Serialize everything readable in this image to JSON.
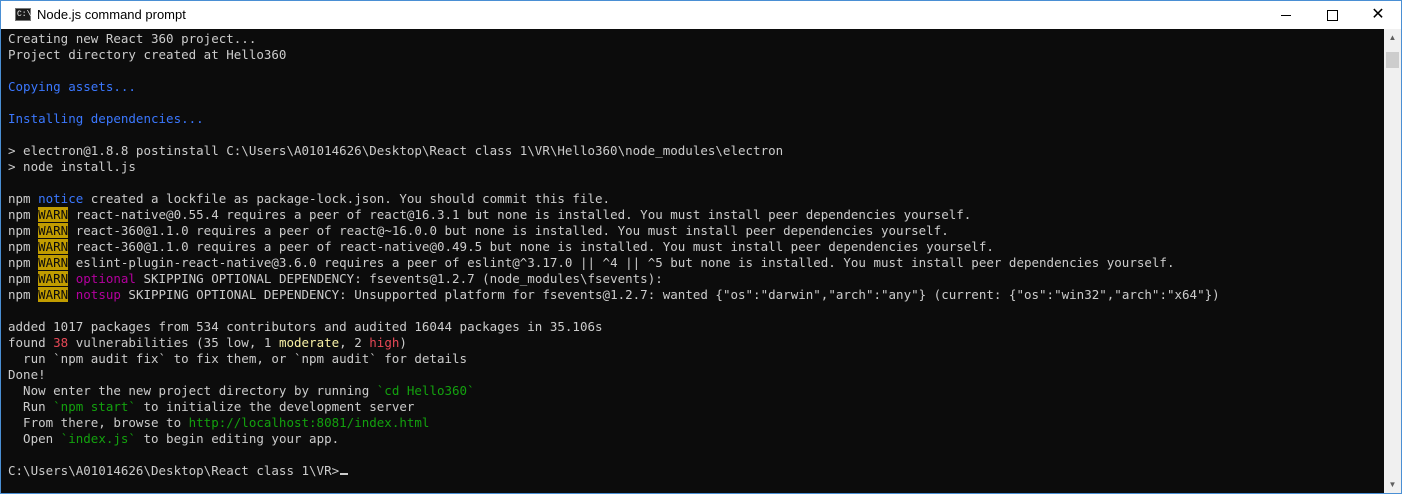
{
  "window": {
    "title": "Node.js command prompt",
    "icon_text": "C:\\",
    "minimize_symbol": "",
    "close_symbol": "✕"
  },
  "colors": {
    "console_bg": "#0c0c0c",
    "text": "#cccccc",
    "blue": "#3b78ff",
    "warn_bg": "#c19c00",
    "magenta": "#b4009e",
    "red": "#e74856",
    "yellow": "#f9f1a5",
    "green": "#13a10e"
  },
  "console": {
    "lines": [
      [
        {
          "t": "Creating new React 360 project..."
        }
      ],
      [
        {
          "t": "Project directory created at Hello360"
        }
      ],
      [],
      [
        {
          "t": "Copying assets...",
          "c": "blue"
        }
      ],
      [],
      [
        {
          "t": "Installing dependencies...",
          "c": "blue"
        }
      ],
      [],
      [
        {
          "t": "> electron@1.8.8 postinstall C:\\Users\\A01014626\\Desktop\\React class 1\\VR\\Hello360\\node_modules\\electron"
        }
      ],
      [
        {
          "t": "> node install.js"
        }
      ],
      [],
      [
        {
          "t": "npm "
        },
        {
          "t": "notice",
          "c": "blue"
        },
        {
          "t": " created a lockfile as package-lock.json. You should commit this file."
        }
      ],
      [
        {
          "t": "npm "
        },
        {
          "t": "WARN",
          "c": "warn"
        },
        {
          "t": " react-native@0.55.4 requires a peer of react@16.3.1 but none is installed. You must install peer dependencies yourself."
        }
      ],
      [
        {
          "t": "npm "
        },
        {
          "t": "WARN",
          "c": "warn"
        },
        {
          "t": " react-360@1.1.0 requires a peer of react@~16.0.0 but none is installed. You must install peer dependencies yourself."
        }
      ],
      [
        {
          "t": "npm "
        },
        {
          "t": "WARN",
          "c": "warn"
        },
        {
          "t": " react-360@1.1.0 requires a peer of react-native@0.49.5 but none is installed. You must install peer dependencies yourself."
        }
      ],
      [
        {
          "t": "npm "
        },
        {
          "t": "WARN",
          "c": "warn"
        },
        {
          "t": " eslint-plugin-react-native@3.6.0 requires a peer of eslint@^3.17.0 || ^4 || ^5 but none is installed. You must install peer dependencies yourself."
        }
      ],
      [
        {
          "t": "npm "
        },
        {
          "t": "WARN",
          "c": "warn"
        },
        {
          "t": " "
        },
        {
          "t": "optional",
          "c": "magenta"
        },
        {
          "t": " SKIPPING OPTIONAL DEPENDENCY: fsevents@1.2.7 (node_modules\\fsevents):"
        }
      ],
      [
        {
          "t": "npm "
        },
        {
          "t": "WARN",
          "c": "warn"
        },
        {
          "t": " "
        },
        {
          "t": "notsup",
          "c": "magenta"
        },
        {
          "t": " SKIPPING OPTIONAL DEPENDENCY: Unsupported platform for fsevents@1.2.7: wanted {\"os\":\"darwin\",\"arch\":\"any\"} (current: {\"os\":\"win32\",\"arch\":\"x64\"})"
        }
      ],
      [],
      [
        {
          "t": "added 1017 packages from 534 contributors and audited 16044 packages in 35.106s"
        }
      ],
      [
        {
          "t": "found "
        },
        {
          "t": "38",
          "c": "red"
        },
        {
          "t": " vulnerabilities (35 low, 1 "
        },
        {
          "t": "moderate",
          "c": "yellow"
        },
        {
          "t": ", 2 "
        },
        {
          "t": "high",
          "c": "red"
        },
        {
          "t": ")"
        }
      ],
      [
        {
          "t": "  run `npm audit fix` to fix them, or `npm audit` for details"
        }
      ],
      [
        {
          "t": "Done!"
        }
      ],
      [
        {
          "t": "  Now enter the new project directory by running "
        },
        {
          "t": "`cd Hello360`",
          "c": "green"
        }
      ],
      [
        {
          "t": "  Run "
        },
        {
          "t": "`npm start`",
          "c": "green"
        },
        {
          "t": " to initialize the development server"
        }
      ],
      [
        {
          "t": "  From there, browse to "
        },
        {
          "t": "http://localhost:8081/index.html",
          "c": "green"
        }
      ],
      [
        {
          "t": "  Open "
        },
        {
          "t": "`index.js`",
          "c": "green"
        },
        {
          "t": " to begin editing your app."
        }
      ],
      [],
      [
        {
          "t": "C:\\Users\\A01014626\\Desktop\\React class 1\\VR>"
        }
      ]
    ]
  }
}
